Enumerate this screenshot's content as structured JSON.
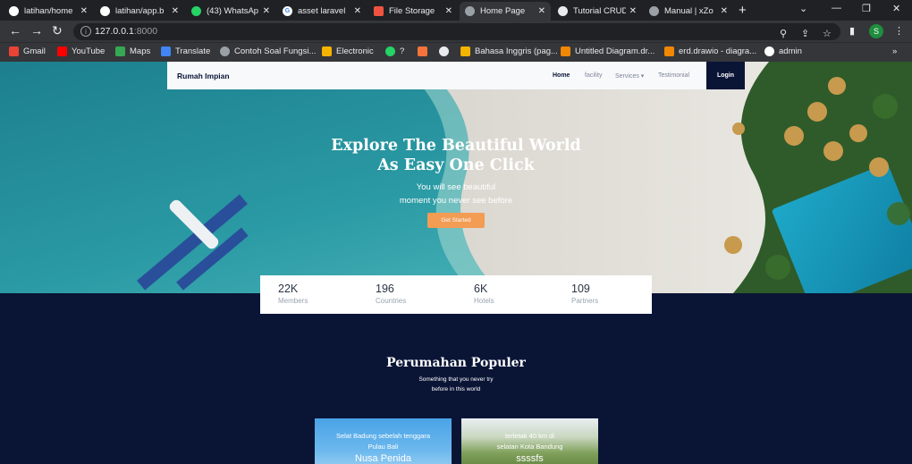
{
  "browser": {
    "tabs": [
      {
        "title": "latihan/home",
        "fav": "github-icon",
        "color": "#ffffff"
      },
      {
        "title": "latihan/app.b",
        "fav": "github-icon",
        "color": "#ffffff"
      },
      {
        "title": "(43) WhatsAp",
        "fav": "whatsapp-icon",
        "color": "#25d366"
      },
      {
        "title": "asset laravel",
        "fav": "google-icon",
        "color": "#ffffff"
      },
      {
        "title": "File Storage",
        "fav": "laravel-icon",
        "color": "#f05340"
      },
      {
        "title": "Home Page",
        "fav": "globe-icon",
        "color": "#9aa0a6"
      },
      {
        "title": "Tutorial CRUD",
        "fav": "globe-icon",
        "color": "#e8eaed"
      },
      {
        "title": "Manual | xZo",
        "fav": "globe-icon",
        "color": "#9aa0a6"
      }
    ],
    "url_host": "127.0.0.1",
    "url_port": ":8000",
    "profile_initial": "S",
    "bookmarks": [
      {
        "label": "Gmail",
        "color": "#ea4335"
      },
      {
        "label": "YouTube",
        "color": "#ff0000"
      },
      {
        "label": "Maps",
        "color": "#34a853"
      },
      {
        "label": "Translate",
        "color": "#4285f4"
      },
      {
        "label": "Contoh Soal Fungsi...",
        "color": "#9aa0a6"
      },
      {
        "label": "Electronic",
        "color": "#f4b400"
      },
      {
        "label": "?",
        "color": "#25d366"
      },
      {
        "label": "",
        "color": "#f4743b"
      },
      {
        "label": "",
        "color": "#e8eaed"
      },
      {
        "label": "Bahasa Inggris (pag...",
        "color": "#f4b400"
      },
      {
        "label": "Untitled Diagram.dr...",
        "color": "#f08705"
      },
      {
        "label": "erd.drawio - diagra...",
        "color": "#f08705"
      },
      {
        "label": "admin",
        "color": "#ffffff"
      }
    ]
  },
  "nav": {
    "brand": "Rumah Impian",
    "links": [
      "Home",
      "facility",
      "Services ▾",
      "Testimonial"
    ],
    "login": "Login"
  },
  "hero": {
    "title_line1": "Explore The Beautiful World",
    "title_line2": "As Easy One Click",
    "sub_line1": "You will see beautiful",
    "sub_line2": "moment you never see before",
    "cta": "Get Started"
  },
  "stats": [
    {
      "value": "22K",
      "label": "Members"
    },
    {
      "value": "196",
      "label": "Countries"
    },
    {
      "value": "6K",
      "label": "Hotels"
    },
    {
      "value": "109",
      "label": "Partners"
    }
  ],
  "popular": {
    "title": "Perumahan Populer",
    "sub_line1": "Something that you never try",
    "sub_line2": "before in this world",
    "cards": [
      {
        "text_line1": "Selat Badung sebelah tenggara",
        "text_line2": "Pulau Bali",
        "name": "Nusa Penida"
      },
      {
        "text_line1": "terletak 40 km di",
        "text_line2": "selatan Kota Bandung",
        "name": "ssssfs"
      }
    ]
  }
}
